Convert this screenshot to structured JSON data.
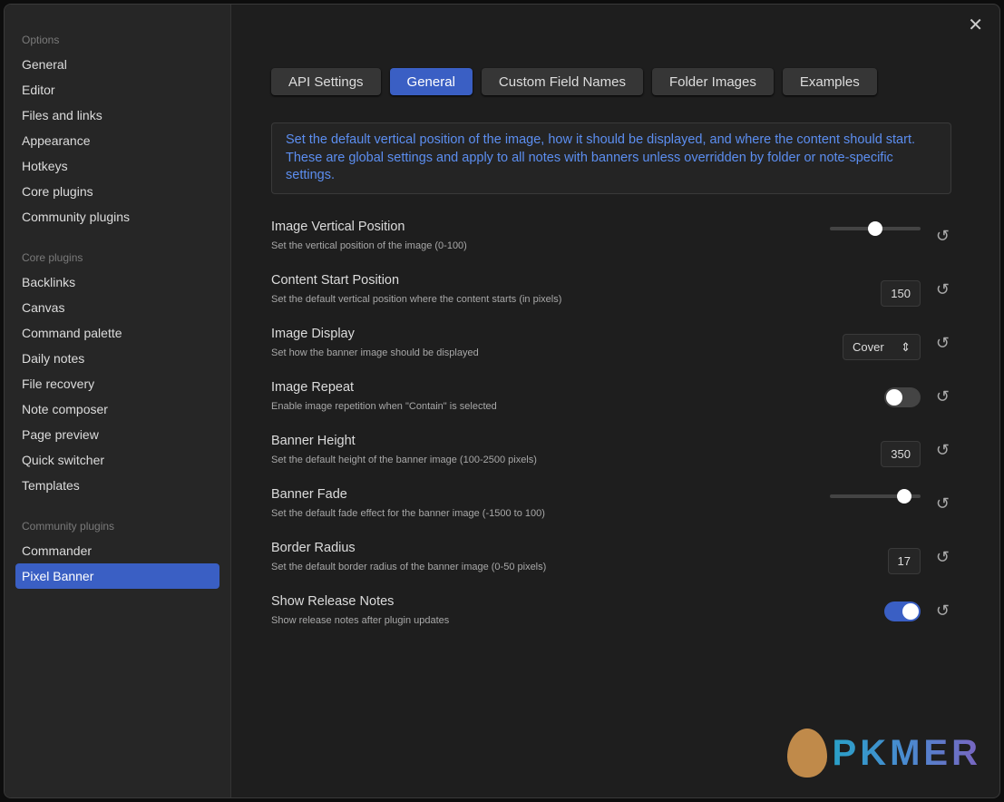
{
  "sidebar": {
    "groups": [
      {
        "heading": "Options",
        "items": [
          "General",
          "Editor",
          "Files and links",
          "Appearance",
          "Hotkeys",
          "Core plugins",
          "Community plugins"
        ]
      },
      {
        "heading": "Core plugins",
        "items": [
          "Backlinks",
          "Canvas",
          "Command palette",
          "Daily notes",
          "File recovery",
          "Note composer",
          "Page preview",
          "Quick switcher",
          "Templates"
        ]
      },
      {
        "heading": "Community plugins",
        "items": [
          "Commander",
          "Pixel Banner"
        ]
      }
    ],
    "active": "Pixel Banner"
  },
  "tabs": [
    "API Settings",
    "General",
    "Custom Field Names",
    "Folder Images",
    "Examples"
  ],
  "active_tab": "General",
  "info": "Set the default vertical position of the image, how it should be displayed, and where the content should start. These are global settings and apply to all notes with banners unless overridden by folder or note-specific settings.",
  "settings": [
    {
      "name": "Image Vertical Position",
      "desc": "Set the vertical position of the image (0-100)",
      "type": "slider",
      "value": 50,
      "min": 0,
      "max": 100
    },
    {
      "name": "Content Start Position",
      "desc": "Set the default vertical position where the content starts (in pixels)",
      "type": "number",
      "value": "150"
    },
    {
      "name": "Image Display",
      "desc": "Set how the banner image should be displayed",
      "type": "select",
      "value": "Cover"
    },
    {
      "name": "Image Repeat",
      "desc": "Enable image repetition when \"Contain\" is selected",
      "type": "toggle",
      "value": false
    },
    {
      "name": "Banner Height",
      "desc": "Set the default height of the banner image (100-2500 pixels)",
      "type": "number",
      "value": "350"
    },
    {
      "name": "Banner Fade",
      "desc": "Set the default fade effect for the banner image (-1500 to 100)",
      "type": "slider",
      "value": -100,
      "min": -1500,
      "max": 100
    },
    {
      "name": "Border Radius",
      "desc": "Set the default border radius of the banner image (0-50 pixels)",
      "type": "number",
      "value": "17"
    },
    {
      "name": "Show Release Notes",
      "desc": "Show release notes after plugin updates",
      "type": "toggle",
      "value": true
    }
  ],
  "watermark": "PKMER",
  "colors": {
    "accent": "#3a5fc4",
    "info_text": "#5c8ef0"
  }
}
